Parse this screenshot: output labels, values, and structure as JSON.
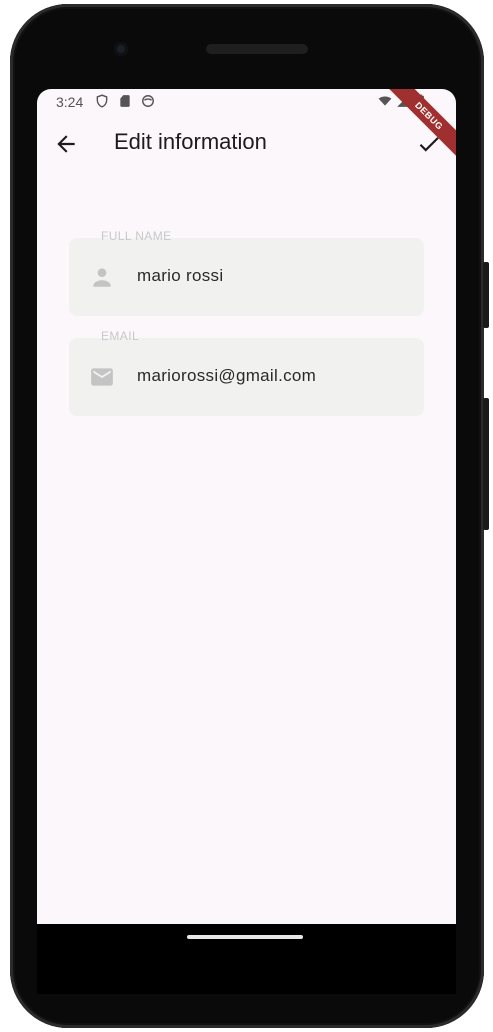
{
  "status_bar": {
    "time": "3:24",
    "left_icons": [
      "shield-icon",
      "sd-card-icon",
      "face-icon"
    ],
    "right_icons": [
      "wifi-icon",
      "signal-icon",
      "battery-icon"
    ],
    "debug_banner": "DEBUG"
  },
  "app_bar": {
    "title": "Edit information",
    "back_icon": "arrow-back-icon",
    "confirm_icon": "check-icon"
  },
  "form": {
    "full_name": {
      "label": "FULL NAME",
      "value": "mario rossi",
      "icon": "person-icon"
    },
    "email": {
      "label": "EMAIL",
      "value": "mariorossi@gmail.com",
      "icon": "mail-icon"
    }
  },
  "colors": {
    "screen_bg": "#fcf7fb",
    "field_bg": "#f1f1f0",
    "debug_banner": "#a0302f"
  }
}
